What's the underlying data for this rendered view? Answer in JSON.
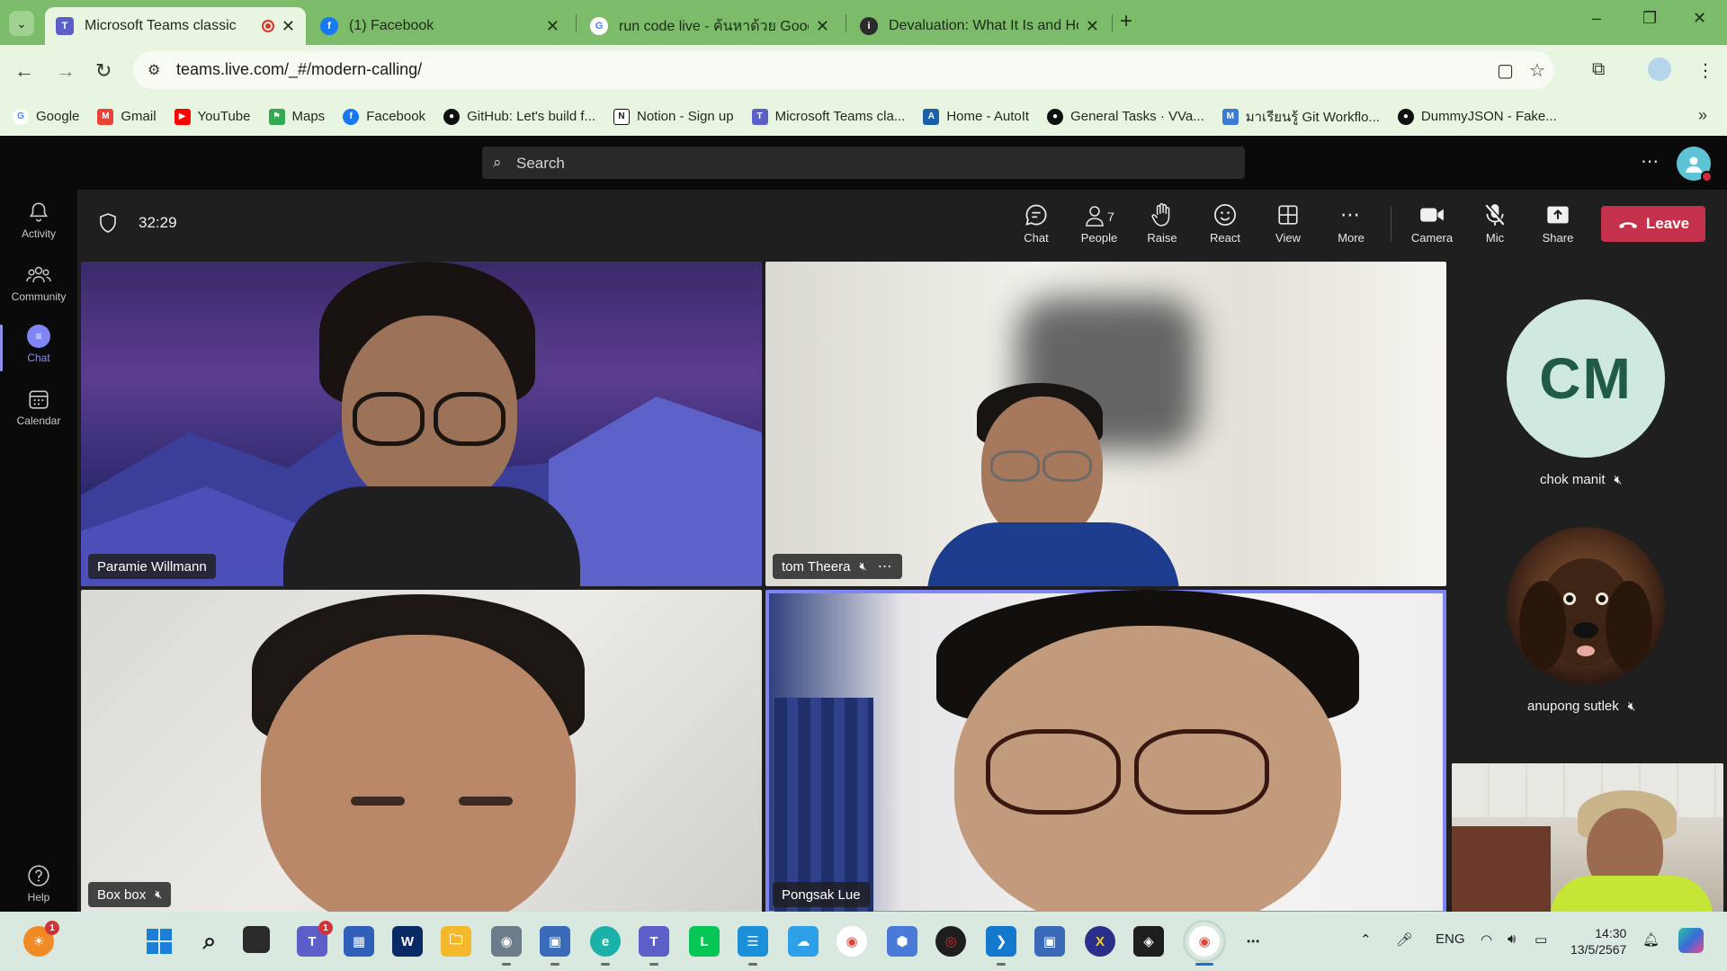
{
  "browser": {
    "tabs": [
      {
        "title": "Microsoft Teams classic",
        "active": true,
        "recording": true,
        "icon": "teams-icon"
      },
      {
        "title": "(1) Facebook",
        "active": false,
        "icon": "facebook-icon"
      },
      {
        "title": "run code live - ค้นหาด้วย Google",
        "active": false,
        "icon": "google-icon"
      },
      {
        "title": "Devaluation: What It Is and How",
        "active": false,
        "icon": "investopedia-icon"
      }
    ],
    "url": "teams.live.com/_#/modern-calling/",
    "bookmarks": [
      {
        "label": "Google",
        "icon": "google-icon",
        "color": "#4285f4"
      },
      {
        "label": "Gmail",
        "icon": "gmail-icon",
        "color": "#ea4335"
      },
      {
        "label": "YouTube",
        "icon": "youtube-icon",
        "color": "#ff0000"
      },
      {
        "label": "Maps",
        "icon": "maps-icon",
        "color": "#34a853"
      },
      {
        "label": "Facebook",
        "icon": "facebook-icon",
        "color": "#1877f2"
      },
      {
        "label": "GitHub: Let's build f...",
        "icon": "github-icon",
        "color": "#111111"
      },
      {
        "label": "Notion - Sign up",
        "icon": "notion-icon",
        "color": "#111111"
      },
      {
        "label": "Microsoft Teams cla...",
        "icon": "teams-icon",
        "color": "#5b5fc7"
      },
      {
        "label": "Home - AutoIt",
        "icon": "autoit-icon",
        "color": "#1b5fa8"
      },
      {
        "label": "General Tasks · VVa...",
        "icon": "github-icon",
        "color": "#111111"
      },
      {
        "label": "มาเรียนรู้ Git Workflo...",
        "icon": "blog-icon",
        "color": "#3a7bd5"
      },
      {
        "label": "DummyJSON - Fake...",
        "icon": "dummyjson-icon",
        "color": "#111111"
      }
    ]
  },
  "teams": {
    "search_placeholder": "Search",
    "rail": [
      {
        "label": "Activity",
        "icon": "bell-icon"
      },
      {
        "label": "Community",
        "icon": "community-icon"
      },
      {
        "label": "Chat",
        "icon": "chat-icon",
        "active": true
      },
      {
        "label": "Calendar",
        "icon": "calendar-icon"
      }
    ],
    "help_label": "Help",
    "meeting": {
      "timer": "32:29",
      "people_count": "7",
      "controls": {
        "chat": "Chat",
        "people": "People",
        "raise": "Raise",
        "react": "React",
        "view": "View",
        "more": "More",
        "camera": "Camera",
        "mic": "Mic",
        "share": "Share",
        "leave": "Leave"
      },
      "participants": [
        {
          "name": "Paramie Willmann",
          "muted": false
        },
        {
          "name": "tom Theera",
          "muted": true
        },
        {
          "name": "Box box",
          "muted": true
        },
        {
          "name": "Pongsak Lue",
          "muted": false,
          "speaking": true
        }
      ],
      "roster": [
        {
          "name": "chok manit",
          "initials": "CM",
          "muted": true,
          "avatar_color": "#cfe8e1",
          "initials_color": "#1f5a4a"
        },
        {
          "name": "anupong sutlek",
          "muted": true,
          "avatar": "dog-photo"
        }
      ]
    }
  },
  "taskbar": {
    "notification_badge": "1",
    "teams_badge": "1",
    "language": "ENG",
    "time": "14:30",
    "date": "13/5/2567"
  }
}
